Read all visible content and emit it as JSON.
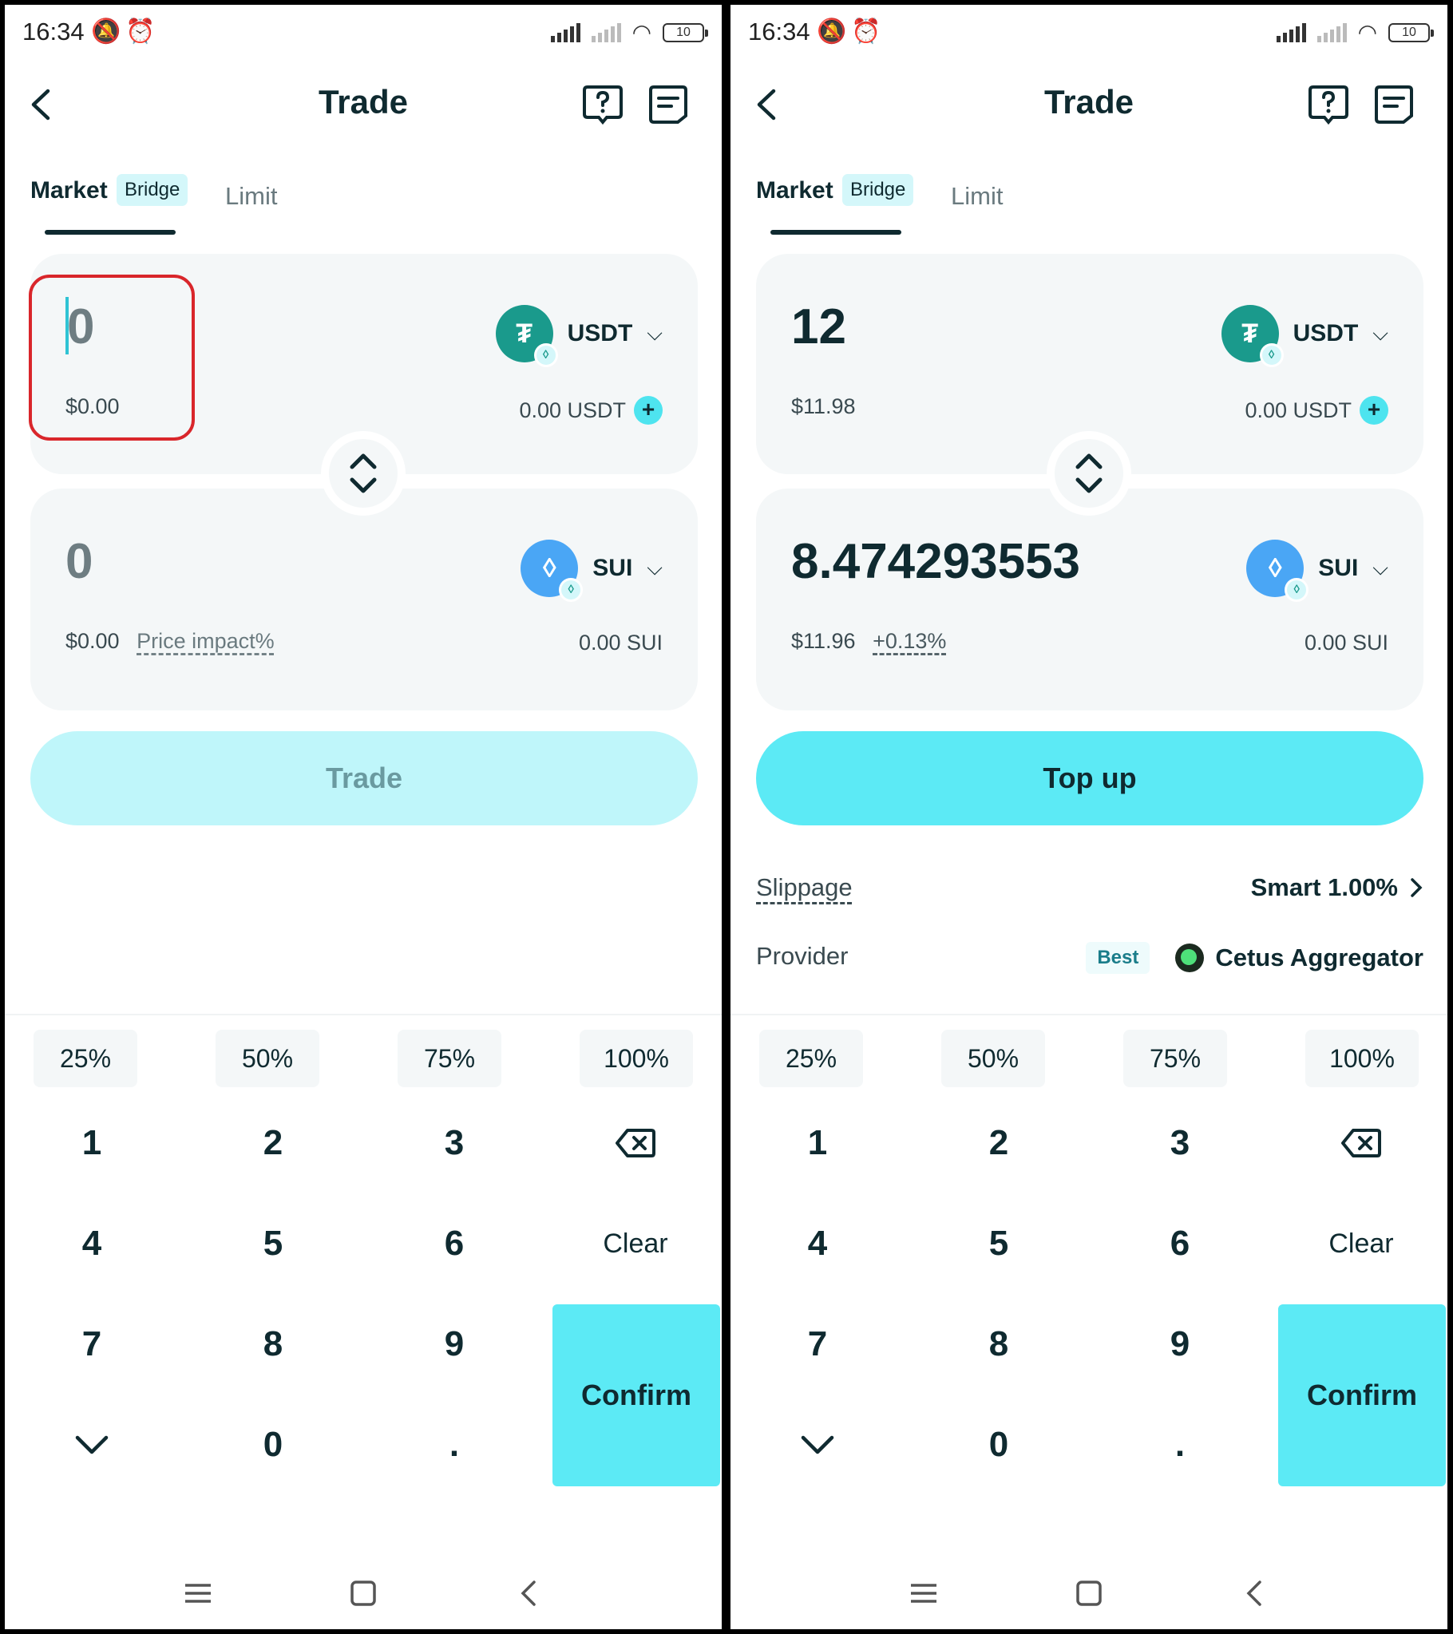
{
  "status_bar": {
    "time": "16:34",
    "battery": "10"
  },
  "header": {
    "title": "Trade"
  },
  "tabs": {
    "market": "Market",
    "bridge_badge": "Bridge",
    "limit": "Limit"
  },
  "keypad": {
    "percentages": [
      "25%",
      "50%",
      "75%",
      "100%"
    ],
    "keys": [
      "1",
      "2",
      "3",
      "4",
      "5",
      "6",
      "7",
      "8",
      "9",
      "0",
      "."
    ],
    "clear": "Clear",
    "confirm": "Confirm"
  },
  "left": {
    "from": {
      "amount": "0",
      "fiat": "$0.00",
      "token": "USDT",
      "balance": "0.00 USDT"
    },
    "to": {
      "amount": "0",
      "fiat": "$0.00",
      "impact": "Price impact%",
      "token": "SUI",
      "balance": "0.00 SUI"
    },
    "action": "Trade"
  },
  "right": {
    "from": {
      "amount": "12",
      "fiat": "$11.98",
      "token": "USDT",
      "balance": "0.00 USDT"
    },
    "to": {
      "amount": "8.474293553",
      "fiat": "$11.96",
      "impact": "+0.13%",
      "token": "SUI",
      "balance": "0.00 SUI"
    },
    "action": "Top up",
    "slippage_label": "Slippage",
    "slippage_value": "Smart 1.00%",
    "provider_label": "Provider",
    "provider_badge": "Best",
    "provider_name": "Cetus Aggregator"
  },
  "colors": {
    "accent": "#5ceaf5",
    "accent_disabled": "#bff6fa",
    "usdt": "#1a9a8c",
    "sui": "#4aa6f5",
    "highlight": "#d9262b"
  }
}
